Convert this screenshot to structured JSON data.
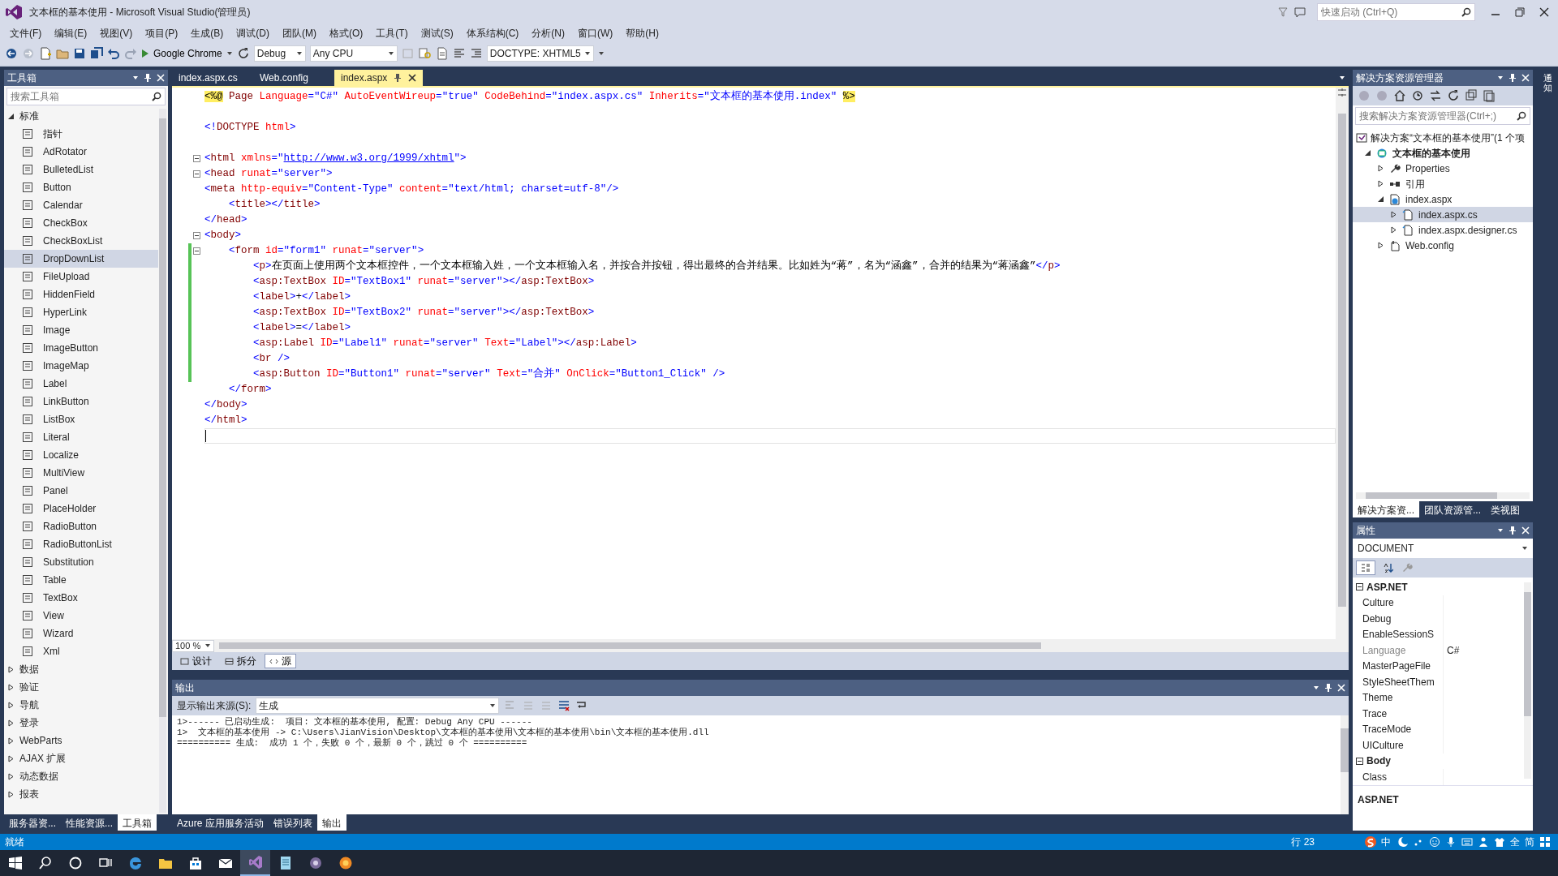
{
  "window": {
    "title": "文本框的基本使用 - Microsoft Visual Studio(管理员)",
    "quick_launch": {
      "placeholder": "快速启动 (Ctrl+Q)"
    }
  },
  "menu": [
    "文件(F)",
    "编辑(E)",
    "视图(V)",
    "项目(P)",
    "生成(B)",
    "调试(D)",
    "团队(M)",
    "格式(O)",
    "工具(T)",
    "测试(S)",
    "体系结构(C)",
    "分析(N)",
    "窗口(W)",
    "帮助(H)"
  ],
  "toolbar": {
    "run_target": "Google Chrome",
    "configuration": "Debug",
    "platform": "Any CPU",
    "doctype": "DOCTYPE: XHTML5"
  },
  "toolbox": {
    "title": "工具箱",
    "search": {
      "placeholder": "搜索工具箱"
    },
    "sections": [
      {
        "label": "标准",
        "expanded": true,
        "items": [
          {
            "label": "指针",
            "selected": false
          },
          {
            "label": "AdRotator",
            "selected": false
          },
          {
            "label": "BulletedList",
            "selected": false
          },
          {
            "label": "Button",
            "selected": false
          },
          {
            "label": "Calendar",
            "selected": false
          },
          {
            "label": "CheckBox",
            "selected": false
          },
          {
            "label": "CheckBoxList",
            "selected": false
          },
          {
            "label": "DropDownList",
            "selected": true
          },
          {
            "label": "FileUpload",
            "selected": false
          },
          {
            "label": "HiddenField",
            "selected": false
          },
          {
            "label": "HyperLink",
            "selected": false
          },
          {
            "label": "Image",
            "selected": false
          },
          {
            "label": "ImageButton",
            "selected": false
          },
          {
            "label": "ImageMap",
            "selected": false
          },
          {
            "label": "Label",
            "selected": false
          },
          {
            "label": "LinkButton",
            "selected": false
          },
          {
            "label": "ListBox",
            "selected": false
          },
          {
            "label": "Literal",
            "selected": false
          },
          {
            "label": "Localize",
            "selected": false
          },
          {
            "label": "MultiView",
            "selected": false
          },
          {
            "label": "Panel",
            "selected": false
          },
          {
            "label": "PlaceHolder",
            "selected": false
          },
          {
            "label": "RadioButton",
            "selected": false
          },
          {
            "label": "RadioButtonList",
            "selected": false
          },
          {
            "label": "Substitution",
            "selected": false
          },
          {
            "label": "Table",
            "selected": false
          },
          {
            "label": "TextBox",
            "selected": false
          },
          {
            "label": "View",
            "selected": false
          },
          {
            "label": "Wizard",
            "selected": false
          },
          {
            "label": "Xml",
            "selected": false
          }
        ]
      },
      {
        "label": "数据",
        "expanded": false
      },
      {
        "label": "验证",
        "expanded": false
      },
      {
        "label": "导航",
        "expanded": false
      },
      {
        "label": "登录",
        "expanded": false
      },
      {
        "label": "WebParts",
        "expanded": false
      },
      {
        "label": "AJAX 扩展",
        "expanded": false
      },
      {
        "label": "动态数据",
        "expanded": false
      },
      {
        "label": "报表",
        "expanded": false
      }
    ],
    "tabs": [
      {
        "label": "服务器资...",
        "selected": false
      },
      {
        "label": "性能资源...",
        "selected": false
      },
      {
        "label": "工具箱",
        "selected": true
      }
    ]
  },
  "editor": {
    "tabs": [
      {
        "label": "index.aspx.cs",
        "selected": false
      },
      {
        "label": "Web.config",
        "selected": false
      },
      {
        "label": "index.aspx",
        "selected": true
      }
    ],
    "lines": [
      {
        "fold": false,
        "changed": false,
        "current": false,
        "tokens": [
          {
            "kind": "directive",
            "text": "<%@"
          },
          {
            "kind": "tag",
            "text": " Page"
          },
          {
            "kind": "attr",
            "text": " Language"
          },
          {
            "kind": "delim",
            "text": "="
          },
          {
            "kind": "value",
            "text": "\"C#\""
          },
          {
            "kind": "attr",
            "text": " AutoEventWireup"
          },
          {
            "kind": "delim",
            "text": "="
          },
          {
            "kind": "value",
            "text": "\"true\""
          },
          {
            "kind": "attr",
            "text": " CodeBehind"
          },
          {
            "kind": "delim",
            "text": "="
          },
          {
            "kind": "value",
            "text": "\"index.aspx.cs\""
          },
          {
            "kind": "attr",
            "text": " Inherits"
          },
          {
            "kind": "delim",
            "text": "="
          },
          {
            "kind": "value",
            "text": "\"文本框的基本使用.index\" "
          },
          {
            "kind": "directive",
            "text": "%>"
          }
        ]
      },
      {
        "fold": false,
        "changed": false,
        "current": false
      },
      {
        "fold": false,
        "changed": false,
        "current": false,
        "tokens": [
          {
            "kind": "delim",
            "text": "<!"
          },
          {
            "kind": "tag",
            "text": "DOCTYPE"
          },
          {
            "kind": "attr",
            "text": " html"
          },
          {
            "kind": "delim",
            "text": ">"
          }
        ]
      },
      {
        "fold": false,
        "changed": false,
        "current": false
      },
      {
        "fold": true,
        "changed": false,
        "current": false,
        "tokens": [
          {
            "kind": "delim",
            "text": "<"
          },
          {
            "kind": "tag",
            "text": "html"
          },
          {
            "kind": "attr",
            "text": " xmlns"
          },
          {
            "kind": "delim",
            "text": "=\""
          },
          {
            "kind": "link",
            "text": "http://www.w3.org/1999/xhtml"
          },
          {
            "kind": "delim",
            "text": "\">"
          }
        ]
      },
      {
        "fold": true,
        "changed": false,
        "current": false,
        "tokens": [
          {
            "kind": "delim",
            "text": "<"
          },
          {
            "kind": "tag",
            "text": "head"
          },
          {
            "kind": "attr",
            "text": " runat"
          },
          {
            "kind": "delim",
            "text": "="
          },
          {
            "kind": "value",
            "text": "\"server\""
          },
          {
            "kind": "delim",
            "text": ">"
          }
        ]
      },
      {
        "fold": false,
        "changed": false,
        "current": false,
        "tokens": [
          {
            "kind": "delim",
            "text": "<"
          },
          {
            "kind": "tag",
            "text": "meta"
          },
          {
            "kind": "attr",
            "text": " http-equiv"
          },
          {
            "kind": "delim",
            "text": "="
          },
          {
            "kind": "value",
            "text": "\"Content-Type\""
          },
          {
            "kind": "attr",
            "text": " content"
          },
          {
            "kind": "delim",
            "text": "="
          },
          {
            "kind": "value",
            "text": "\"text/html; charset=utf-8\""
          },
          {
            "kind": "delim",
            "text": "/>"
          }
        ]
      },
      {
        "fold": false,
        "changed": false,
        "current": false,
        "tokens": [
          {
            "kind": "delim",
            "text": "    <"
          },
          {
            "kind": "tag",
            "text": "title"
          },
          {
            "kind": "delim",
            "text": "></"
          },
          {
            "kind": "tag",
            "text": "title"
          },
          {
            "kind": "delim",
            "text": ">"
          }
        ]
      },
      {
        "fold": false,
        "changed": false,
        "current": false,
        "tokens": [
          {
            "kind": "delim",
            "text": "</"
          },
          {
            "kind": "tag",
            "text": "head"
          },
          {
            "kind": "delim",
            "text": ">"
          }
        ]
      },
      {
        "fold": true,
        "changed": false,
        "current": false,
        "tokens": [
          {
            "kind": "delim",
            "text": "<"
          },
          {
            "kind": "tag",
            "text": "body"
          },
          {
            "kind": "delim",
            "text": ">"
          }
        ]
      },
      {
        "fold": true,
        "changed": true,
        "current": false,
        "tokens": [
          {
            "kind": "delim",
            "text": "    <"
          },
          {
            "kind": "tag",
            "text": "form"
          },
          {
            "kind": "attr",
            "text": " id"
          },
          {
            "kind": "delim",
            "text": "="
          },
          {
            "kind": "value",
            "text": "\"form1\""
          },
          {
            "kind": "attr",
            "text": " runat"
          },
          {
            "kind": "delim",
            "text": "="
          },
          {
            "kind": "value",
            "text": "\"server\""
          },
          {
            "kind": "delim",
            "text": ">"
          }
        ]
      },
      {
        "fold": false,
        "changed": true,
        "current": false,
        "tokens": [
          {
            "kind": "delim",
            "text": "        <"
          },
          {
            "kind": "tag",
            "text": "p"
          },
          {
            "kind": "delim",
            "text": ">"
          },
          {
            "kind": "text",
            "text": "在页面上使用两个文本框控件，一个文本框输入姓，一个文本框输入名，并按合并按钮，得出最终的合并结果。比如姓为“蒋”，名为“涵鑫”，合并的结果为“蒋涵鑫”"
          },
          {
            "kind": "delim",
            "text": "</"
          },
          {
            "kind": "tag",
            "text": "p"
          },
          {
            "kind": "delim",
            "text": ">"
          }
        ]
      },
      {
        "fold": false,
        "changed": true,
        "current": false,
        "tokens": [
          {
            "kind": "delim",
            "text": "        <"
          },
          {
            "kind": "tag",
            "text": "asp:TextBox"
          },
          {
            "kind": "attr",
            "text": " ID"
          },
          {
            "kind": "delim",
            "text": "="
          },
          {
            "kind": "value",
            "text": "\"TextBox1\""
          },
          {
            "kind": "attr",
            "text": " runat"
          },
          {
            "kind": "delim",
            "text": "="
          },
          {
            "kind": "value",
            "text": "\"server\""
          },
          {
            "kind": "delim",
            "text": "></"
          },
          {
            "kind": "tag",
            "text": "asp:TextBox"
          },
          {
            "kind": "delim",
            "text": ">"
          }
        ]
      },
      {
        "fold": false,
        "changed": true,
        "current": false,
        "tokens": [
          {
            "kind": "delim",
            "text": "        <"
          },
          {
            "kind": "tag",
            "text": "label"
          },
          {
            "kind": "delim",
            "text": ">"
          },
          {
            "kind": "text",
            "text": "+"
          },
          {
            "kind": "delim",
            "text": "</"
          },
          {
            "kind": "tag",
            "text": "label"
          },
          {
            "kind": "delim",
            "text": ">"
          }
        ]
      },
      {
        "fold": false,
        "changed": true,
        "current": false,
        "tokens": [
          {
            "kind": "delim",
            "text": "        <"
          },
          {
            "kind": "tag",
            "text": "asp:TextBox"
          },
          {
            "kind": "attr",
            "text": " ID"
          },
          {
            "kind": "delim",
            "text": "="
          },
          {
            "kind": "value",
            "text": "\"TextBox2\""
          },
          {
            "kind": "attr",
            "text": " runat"
          },
          {
            "kind": "delim",
            "text": "="
          },
          {
            "kind": "value",
            "text": "\"server\""
          },
          {
            "kind": "delim",
            "text": "></"
          },
          {
            "kind": "tag",
            "text": "asp:TextBox"
          },
          {
            "kind": "delim",
            "text": ">"
          }
        ]
      },
      {
        "fold": false,
        "changed": true,
        "current": false,
        "tokens": [
          {
            "kind": "delim",
            "text": "        <"
          },
          {
            "kind": "tag",
            "text": "label"
          },
          {
            "kind": "delim",
            "text": ">"
          },
          {
            "kind": "text",
            "text": "="
          },
          {
            "kind": "delim",
            "text": "</"
          },
          {
            "kind": "tag",
            "text": "label"
          },
          {
            "kind": "delim",
            "text": ">"
          }
        ]
      },
      {
        "fold": false,
        "changed": true,
        "current": false,
        "tokens": [
          {
            "kind": "delim",
            "text": "        <"
          },
          {
            "kind": "tag",
            "text": "asp:Label"
          },
          {
            "kind": "attr",
            "text": " ID"
          },
          {
            "kind": "delim",
            "text": "="
          },
          {
            "kind": "value",
            "text": "\"Label1\""
          },
          {
            "kind": "attr",
            "text": " runat"
          },
          {
            "kind": "delim",
            "text": "="
          },
          {
            "kind": "value",
            "text": "\"server\""
          },
          {
            "kind": "attr",
            "text": " Text"
          },
          {
            "kind": "delim",
            "text": "="
          },
          {
            "kind": "value",
            "text": "\"Label\""
          },
          {
            "kind": "delim",
            "text": "></"
          },
          {
            "kind": "tag",
            "text": "asp:Label"
          },
          {
            "kind": "delim",
            "text": ">"
          }
        ]
      },
      {
        "fold": false,
        "changed": true,
        "current": false,
        "tokens": [
          {
            "kind": "delim",
            "text": "        <"
          },
          {
            "kind": "tag",
            "text": "br"
          },
          {
            "kind": "delim",
            "text": " />"
          }
        ]
      },
      {
        "fold": false,
        "changed": true,
        "current": false,
        "tokens": [
          {
            "kind": "delim",
            "text": "        <"
          },
          {
            "kind": "tag",
            "text": "asp:Button"
          },
          {
            "kind": "attr",
            "text": " ID"
          },
          {
            "kind": "delim",
            "text": "="
          },
          {
            "kind": "value",
            "text": "\"Button1\""
          },
          {
            "kind": "attr",
            "text": " runat"
          },
          {
            "kind": "delim",
            "text": "="
          },
          {
            "kind": "value",
            "text": "\"server\""
          },
          {
            "kind": "attr",
            "text": " Text"
          },
          {
            "kind": "delim",
            "text": "="
          },
          {
            "kind": "value",
            "text": "\"合并\""
          },
          {
            "kind": "attr",
            "text": " OnClick"
          },
          {
            "kind": "delim",
            "text": "="
          },
          {
            "kind": "value",
            "text": "\"Button1_Click\""
          },
          {
            "kind": "delim",
            "text": " />"
          }
        ]
      },
      {
        "fold": false,
        "changed": false,
        "current": false,
        "tokens": [
          {
            "kind": "delim",
            "text": "    </"
          },
          {
            "kind": "tag",
            "text": "form"
          },
          {
            "kind": "delim",
            "text": ">"
          }
        ]
      },
      {
        "fold": false,
        "changed": false,
        "current": false,
        "tokens": [
          {
            "kind": "delim",
            "text": "</"
          },
          {
            "kind": "tag",
            "text": "body"
          },
          {
            "kind": "delim",
            "text": ">"
          }
        ]
      },
      {
        "fold": false,
        "changed": false,
        "current": false,
        "tokens": [
          {
            "kind": "delim",
            "text": "</"
          },
          {
            "kind": "tag",
            "text": "html"
          },
          {
            "kind": "delim",
            "text": ">"
          }
        ]
      },
      {
        "fold": false,
        "changed": false,
        "current": true
      }
    ],
    "zoom": "100 %",
    "view_tabs": [
      {
        "label": "设计",
        "selected": false
      },
      {
        "label": "拆分",
        "selected": false
      },
      {
        "label": "源",
        "selected": true
      }
    ]
  },
  "output": {
    "title": "输出",
    "source_label": "显示输出来源(S):",
    "source": "生成",
    "lines": [
      "1>------ 已启动生成:  项目: 文本框的基本使用, 配置: Debug Any CPU ------",
      "1>  文本框的基本使用 -> C:\\Users\\JianVision\\Desktop\\文本框的基本使用\\文本框的基本使用\\bin\\文本框的基本使用.dll",
      "========== 生成:  成功 1 个，失败 0 个，最新 0 个，跳过 0 个 =========="
    ],
    "tabs": [
      {
        "label": "Azure 应用服务活动",
        "selected": false
      },
      {
        "label": "错误列表",
        "selected": false
      },
      {
        "label": "输出",
        "selected": true
      }
    ]
  },
  "solution_explorer": {
    "title": "解决方案资源管理器",
    "search": {
      "placeholder": "搜索解决方案资源管理器(Ctrl+;)"
    },
    "solution": "解决方案“文本框的基本使用”(1 个项",
    "tree": [
      {
        "label": "文本框的基本使用",
        "kind": "project",
        "expanded": true,
        "selected": false,
        "children": [
          {
            "label": "Properties",
            "kind": "properties",
            "expanded": false,
            "selected": false
          },
          {
            "label": "引用",
            "kind": "references",
            "expanded": false,
            "selected": false
          },
          {
            "label": "index.aspx",
            "kind": "page",
            "expanded": true,
            "selected": false,
            "children": [
              {
                "label": "index.aspx.cs",
                "kind": "code",
                "expanded": false,
                "selected": true
              },
              {
                "label": "index.aspx.designer.cs",
                "kind": "code",
                "expanded": false,
                "selected": false
              }
            ]
          },
          {
            "label": "Web.config",
            "kind": "config",
            "expanded": false,
            "selected": false
          }
        ]
      }
    ],
    "tabs": [
      {
        "label": "解决方案资...",
        "selected": true
      },
      {
        "label": "团队资源管...",
        "selected": false
      },
      {
        "label": "类视图",
        "selected": false
      }
    ]
  },
  "properties": {
    "title": "属性",
    "object": "DOCUMENT",
    "categorized": true,
    "categories": [
      {
        "label": "ASP.NET",
        "expanded": true,
        "rows": [
          {
            "name": "Culture",
            "disabled": false
          },
          {
            "name": "Debug",
            "disabled": false
          },
          {
            "name": "EnableSessionS",
            "disabled": false
          },
          {
            "name": "Language",
            "value": "C#",
            "disabled": true
          },
          {
            "name": "MasterPageFile",
            "disabled": false
          },
          {
            "name": "StyleSheetThem",
            "disabled": false
          },
          {
            "name": "Theme",
            "disabled": false
          },
          {
            "name": "Trace",
            "disabled": false
          },
          {
            "name": "TraceMode",
            "disabled": false
          },
          {
            "name": "UICulture",
            "disabled": false
          }
        ]
      },
      {
        "label": "Body",
        "expanded": true,
        "rows": [
          {
            "name": "Class",
            "disabled": false
          }
        ]
      }
    ],
    "description": "ASP.NET"
  },
  "notifications": "通知",
  "status_bar": {
    "message": "就绪",
    "line": "行 23"
  },
  "ime": {
    "mode": "中",
    "char_width": "全",
    "script": "简"
  },
  "taskbar": {
    "apps": [
      {
        "kind": "edge",
        "active": false
      },
      {
        "kind": "explorer",
        "active": false
      },
      {
        "kind": "store",
        "active": false
      },
      {
        "kind": "mail",
        "active": false
      },
      {
        "kind": "vs",
        "active": true
      },
      {
        "kind": "notepad",
        "active": false
      },
      {
        "kind": "app",
        "active": false
      },
      {
        "kind": "browser",
        "active": false
      }
    ]
  }
}
